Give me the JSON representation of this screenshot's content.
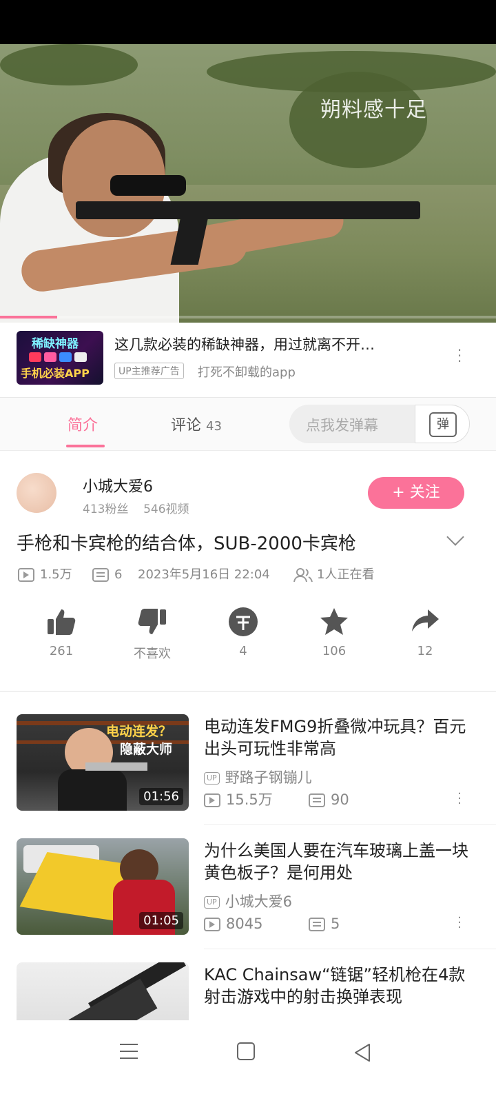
{
  "player": {
    "watermark": "朔料感十足",
    "progress_fraction": 0.115
  },
  "ad": {
    "thumb_line1": "稀缺神器",
    "thumb_line2": "手机必装APP",
    "title": "这几款必装的稀缺神器，用过就离不开…",
    "tag": "UP主推荐广告",
    "subtitle": "打死不卸载的app"
  },
  "tabs": {
    "intro": "简介",
    "comments_label": "评论",
    "comments_count": "43",
    "danmaku_placeholder": "点我发弹幕",
    "danmaku_icon_text": "弹"
  },
  "uploader": {
    "name": "小城大爱6",
    "fans": "413粉丝",
    "videos": "546视频",
    "follow_label": "+ 关注"
  },
  "video": {
    "title": "手枪和卡宾枪的结合体，SUB-2000卡宾枪",
    "views": "1.5万",
    "danmaku_count": "6",
    "date": "2023年5月16日 22:04",
    "watching": "1人正在看"
  },
  "actions": [
    {
      "name": "like",
      "label": "261",
      "icon": "thumbs-up-icon"
    },
    {
      "name": "dislike",
      "label": "不喜欢",
      "icon": "thumbs-down-icon"
    },
    {
      "name": "coin",
      "label": "4",
      "icon": "coin-icon"
    },
    {
      "name": "favorite",
      "label": "106",
      "icon": "star-icon"
    },
    {
      "name": "share",
      "label": "12",
      "icon": "share-icon"
    }
  ],
  "recommendations": [
    {
      "title": "电动连发FMG9折叠微冲玩具？百元出头可玩性非常高",
      "uploader": "野路子钢镚儿",
      "views": "15.5万",
      "danmaku": "90",
      "duration": "01:56",
      "thumb_caption": "电动连发？",
      "thumb_caption2": "隐蔽大师"
    },
    {
      "title": "为什么美国人要在汽车玻璃上盖一块黄色板子？是何用处",
      "uploader": "小城大爱6",
      "views": "8045",
      "danmaku": "5",
      "duration": "01:05"
    },
    {
      "title": "KAC Chainsaw“链锯”轻机枪在4款射击游戏中的射击换弹表现"
    }
  ],
  "up_badge": "UP",
  "colors": {
    "accent": "#fb7299",
    "text": "#222222",
    "muted": "#888888"
  }
}
